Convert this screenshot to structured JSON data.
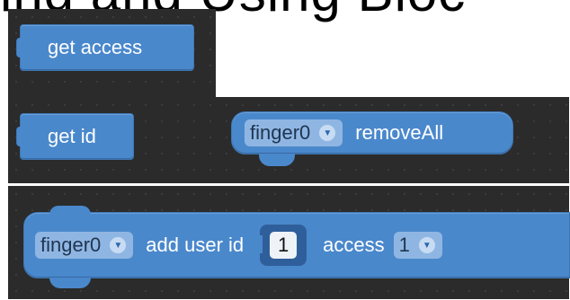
{
  "heading_fragment": "ing and Using Bloc",
  "blocks": {
    "get_access": {
      "label": "get access"
    },
    "get_id": {
      "label": "get id"
    },
    "remove_all": {
      "device": "finger0",
      "label": "removeAll"
    },
    "add_user": {
      "device": "finger0",
      "label_add_user_id": "add user id",
      "user_id_value": "1",
      "label_access": "access",
      "access_value": "1"
    }
  },
  "icons": {
    "dropdown": "chevron-down-icon"
  },
  "colors": {
    "block_fill": "#4a88cc",
    "dropdown_fill": "#8fb6e3",
    "workspace_bg": "#2b2b2b"
  }
}
